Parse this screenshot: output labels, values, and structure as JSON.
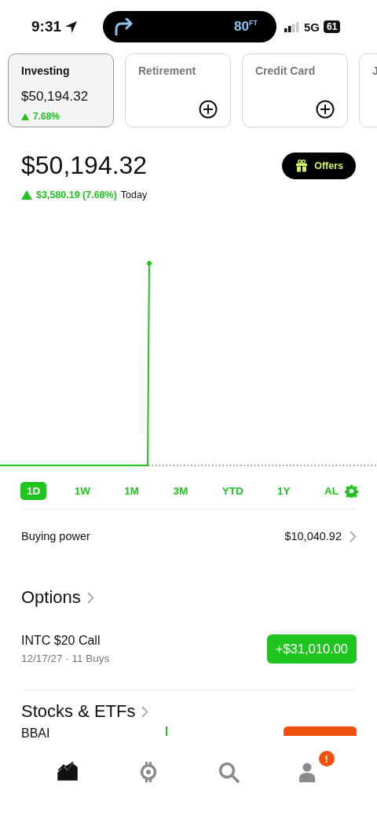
{
  "status_bar": {
    "time": "9:31",
    "activity": {
      "distance": "80$^{FT}$"
    },
    "network": "5G",
    "battery": "61"
  },
  "accounts": [
    {
      "name": "Investing",
      "selected": true,
      "kind": "account",
      "value": "$50,194.32",
      "change": "7.68%"
    },
    {
      "name": "Retirement",
      "selected": false,
      "kind": "add"
    },
    {
      "name": "Credit Card",
      "selected": false,
      "kind": "add"
    },
    {
      "name": "J",
      "selected": false,
      "kind": "label"
    }
  ],
  "portfolio": {
    "value": "$50,194.32",
    "change": "$3,580.19 (7.68%)",
    "period": "Today",
    "offers_button": "Offers"
  },
  "ranges": [
    {
      "label": "1D",
      "selected": true
    },
    {
      "label": "1W",
      "selected": false
    },
    {
      "label": "1M",
      "selected": false
    },
    {
      "label": "3M",
      "selected": false
    },
    {
      "label": "YTD",
      "selected": false
    },
    {
      "label": "1Y",
      "selected": false
    },
    {
      "label": "AL",
      "selected": false
    }
  ],
  "buying_power": {
    "label": "Buying power",
    "value": "$10,040.92"
  },
  "options": {
    "title": "Options",
    "positions": [
      {
        "name": "INTC $20 Call",
        "detail": "12/17/27 · 11 Buys",
        "value": "+$31,010.00",
        "color": "#1fc41f"
      }
    ]
  },
  "stocks": {
    "title": "Stocks & ETFs",
    "positions": [
      {
        "name": "BBAI",
        "color": "#f2500f"
      }
    ]
  },
  "tab_bar": [
    {
      "kind": "chart",
      "selected": true
    },
    {
      "kind": "crypto",
      "selected": false
    },
    {
      "kind": "search",
      "selected": false
    },
    {
      "kind": "account",
      "selected": false,
      "badge": "!"
    }
  ]
}
